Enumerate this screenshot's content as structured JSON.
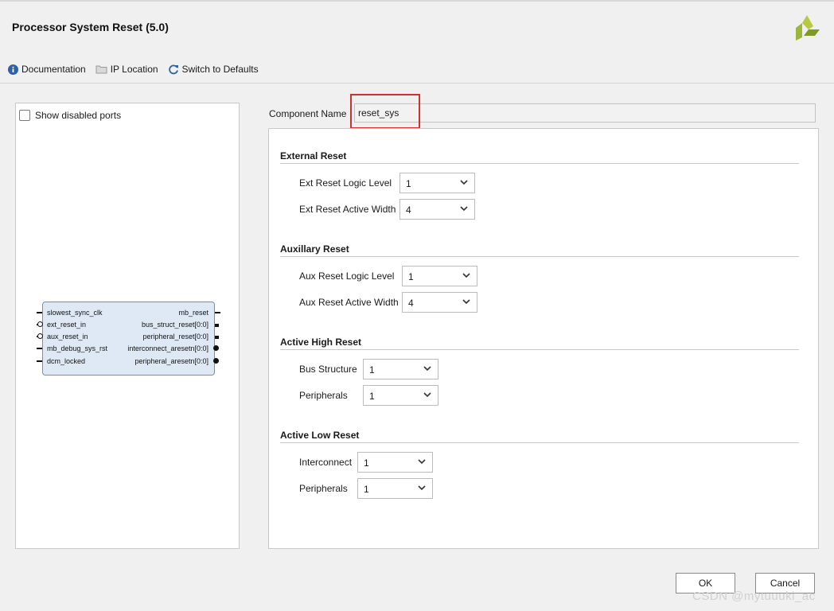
{
  "window": {
    "title": "Processor System Reset (5.0)"
  },
  "toolbar": {
    "documentation": "Documentation",
    "ip_location": "IP Location",
    "switch_defaults": "Switch to Defaults"
  },
  "left_panel": {
    "show_disabled_ports": "Show disabled ports",
    "show_disabled_checked": false,
    "block": {
      "inputs": [
        "slowest_sync_clk",
        "ext_reset_in",
        "aux_reset_in",
        "mb_debug_sys_rst",
        "dcm_locked"
      ],
      "outputs": [
        "mb_reset",
        "bus_struct_reset[0:0]",
        "peripheral_reset[0:0]",
        "interconnect_aresetn[0:0]",
        "peripheral_aresetn[0:0]"
      ]
    }
  },
  "component": {
    "label": "Component Name",
    "value": "reset_sys"
  },
  "sections": {
    "external": {
      "title": "External Reset",
      "logic_level_label": "Ext Reset Logic Level",
      "logic_level_value": "1",
      "active_width_label": "Ext Reset Active Width",
      "active_width_value": "4"
    },
    "auxillary": {
      "title": "Auxillary Reset",
      "logic_level_label": "Aux Reset Logic Level",
      "logic_level_value": "1",
      "active_width_label": "Aux Reset Active Width",
      "active_width_value": "4"
    },
    "active_high": {
      "title": "Active High Reset",
      "bus_structure_label": "Bus Structure",
      "bus_structure_value": "1",
      "peripherals_label": "Peripherals",
      "peripherals_value": "1"
    },
    "active_low": {
      "title": "Active Low Reset",
      "interconnect_label": "Interconnect",
      "interconnect_value": "1",
      "peripherals_label": "Peripherals",
      "peripherals_value": "1"
    }
  },
  "buttons": {
    "ok": "OK",
    "cancel": "Cancel"
  },
  "watermark": "CSDN @mytuuuki_ac",
  "colors": {
    "highlight_box": "#d32f2f",
    "block_fill": "#dfe9f5",
    "logo": "#8aa82a"
  }
}
